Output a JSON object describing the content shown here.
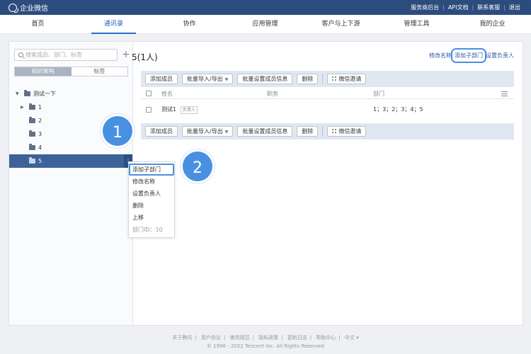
{
  "topbar": {
    "brand": "企业微信",
    "links": [
      "服务商后台",
      "API文档",
      "联系客服",
      "退出"
    ]
  },
  "nav": {
    "tabs": [
      "首页",
      "通讯录",
      "协作",
      "应用管理",
      "客户与上下游",
      "管理工具",
      "我的企业"
    ],
    "active": "通讯录"
  },
  "sidebar": {
    "search_placeholder": "搜索成员、部门、标签",
    "segments": [
      "组织架构",
      "标签"
    ],
    "root": "测试一下",
    "children": [
      "1",
      "2",
      "3",
      "4",
      "5"
    ]
  },
  "context_menu": {
    "items": [
      "添加子部门",
      "修改名称",
      "设置负责人",
      "删除",
      "上移"
    ],
    "dept_id": "部门ID：10"
  },
  "main": {
    "title": "5(1人)",
    "title_links": [
      "修改名称",
      "添加子部门",
      "设置负责人"
    ],
    "toolbar": {
      "add_member": "添加成员",
      "batch_import": "批量导入/导出",
      "batch_set": "批量设置成员信息",
      "delete": "删除",
      "invite": "微信邀请"
    },
    "table": {
      "headers": [
        "姓名",
        "职务",
        "部门"
      ],
      "rows": [
        {
          "name": "测试1",
          "tag": "负责人",
          "title": "",
          "dept": "1；3；2；3；4；5"
        }
      ]
    }
  },
  "badges": [
    "1",
    "2"
  ],
  "colors": {
    "topbar": "#2c4c7e",
    "accent": "#4a90e2",
    "selected": "#3d6299"
  },
  "footer": {
    "links": [
      "关于腾讯",
      "用户协议",
      "使用规范",
      "隐私政策",
      "更新日志",
      "帮助中心",
      "中文 ▾"
    ],
    "copyright": "© 1998 - 2022 Tencent Inc. All Rights Reserved"
  }
}
